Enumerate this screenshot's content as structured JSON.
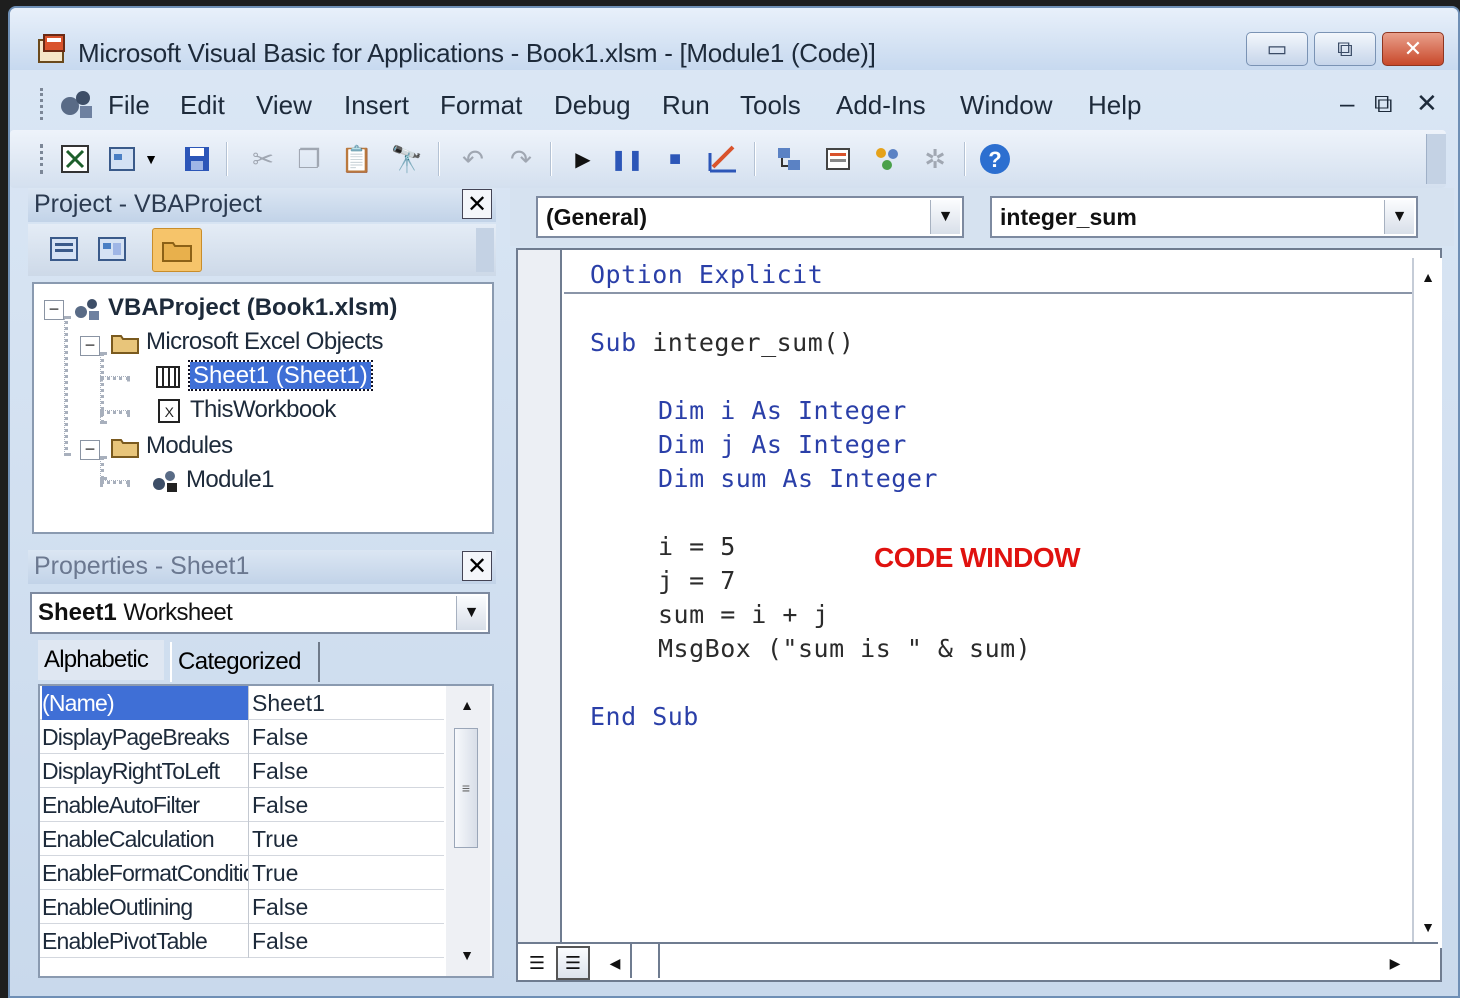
{
  "window": {
    "title": "Microsoft Visual Basic for Applications - Book1.xlsm - [Module1 (Code)]",
    "minimize_label": "▭",
    "restore_label": "⧉",
    "close_label": "✕"
  },
  "menu": {
    "items": [
      "File",
      "Edit",
      "View",
      "Insert",
      "Format",
      "Debug",
      "Run",
      "Tools",
      "Add-Ins",
      "Window",
      "Help"
    ],
    "mdi_minimize": "–",
    "mdi_restore": "⧉",
    "mdi_close": "✕"
  },
  "toolbar": {
    "icons": [
      "view-excel-icon",
      "insert-userform-icon",
      "save-icon",
      "cut-icon",
      "copy-icon",
      "paste-icon",
      "find-icon",
      "undo-icon",
      "redo-icon",
      "run-icon",
      "break-icon",
      "reset-icon",
      "design-mode-icon",
      "project-explorer-icon",
      "properties-window-icon",
      "object-browser-icon",
      "toolbox-icon",
      "help-icon"
    ]
  },
  "project": {
    "header": "Project - VBAProject",
    "close": "✕",
    "tree": {
      "root": "VBAProject (Book1.xlsm)",
      "excel_objects": "Microsoft Excel Objects",
      "sheet1": "Sheet1 (Sheet1)",
      "thisworkbook": "ThisWorkbook",
      "modules": "Modules",
      "module1": "Module1"
    }
  },
  "properties": {
    "header": "Properties - Sheet1",
    "close": "✕",
    "object_name": "Sheet1",
    "object_type": "Worksheet",
    "tabs": [
      "Alphabetic",
      "Categorized"
    ],
    "rows": [
      {
        "name": "(Name)",
        "value": "Sheet1"
      },
      {
        "name": "DisplayPageBreaks",
        "value": "False"
      },
      {
        "name": "DisplayRightToLeft",
        "value": "False"
      },
      {
        "name": "EnableAutoFilter",
        "value": "False"
      },
      {
        "name": "EnableCalculation",
        "value": "True"
      },
      {
        "name": "EnableFormatConditionsCalculation",
        "value": "True"
      },
      {
        "name": "EnableOutlining",
        "value": "False"
      },
      {
        "name": "EnablePivotTable",
        "value": "False"
      }
    ]
  },
  "code_window": {
    "object_combo": "(General)",
    "procedure_combo": "integer_sum",
    "annotation": "CODE WINDOW",
    "annotation_color": "#e0120f",
    "lines": {
      "l1": "Option Explicit",
      "l2_kw": "Sub",
      "l2_rest": " integer_sum()",
      "l3_kw1": "Dim",
      "l3_mid": " i ",
      "l3_kw2": "As Integer",
      "l4_kw1": "Dim",
      "l4_mid": " j ",
      "l4_kw2": "As Integer",
      "l5_kw1": "Dim",
      "l5_mid": " sum ",
      "l5_kw2": "As Integer",
      "l6": "i = 5",
      "l7": "j = 7",
      "l8": "sum = i + j",
      "l9": "MsgBox (\"sum is \" & sum)",
      "l10": "End Sub"
    }
  }
}
